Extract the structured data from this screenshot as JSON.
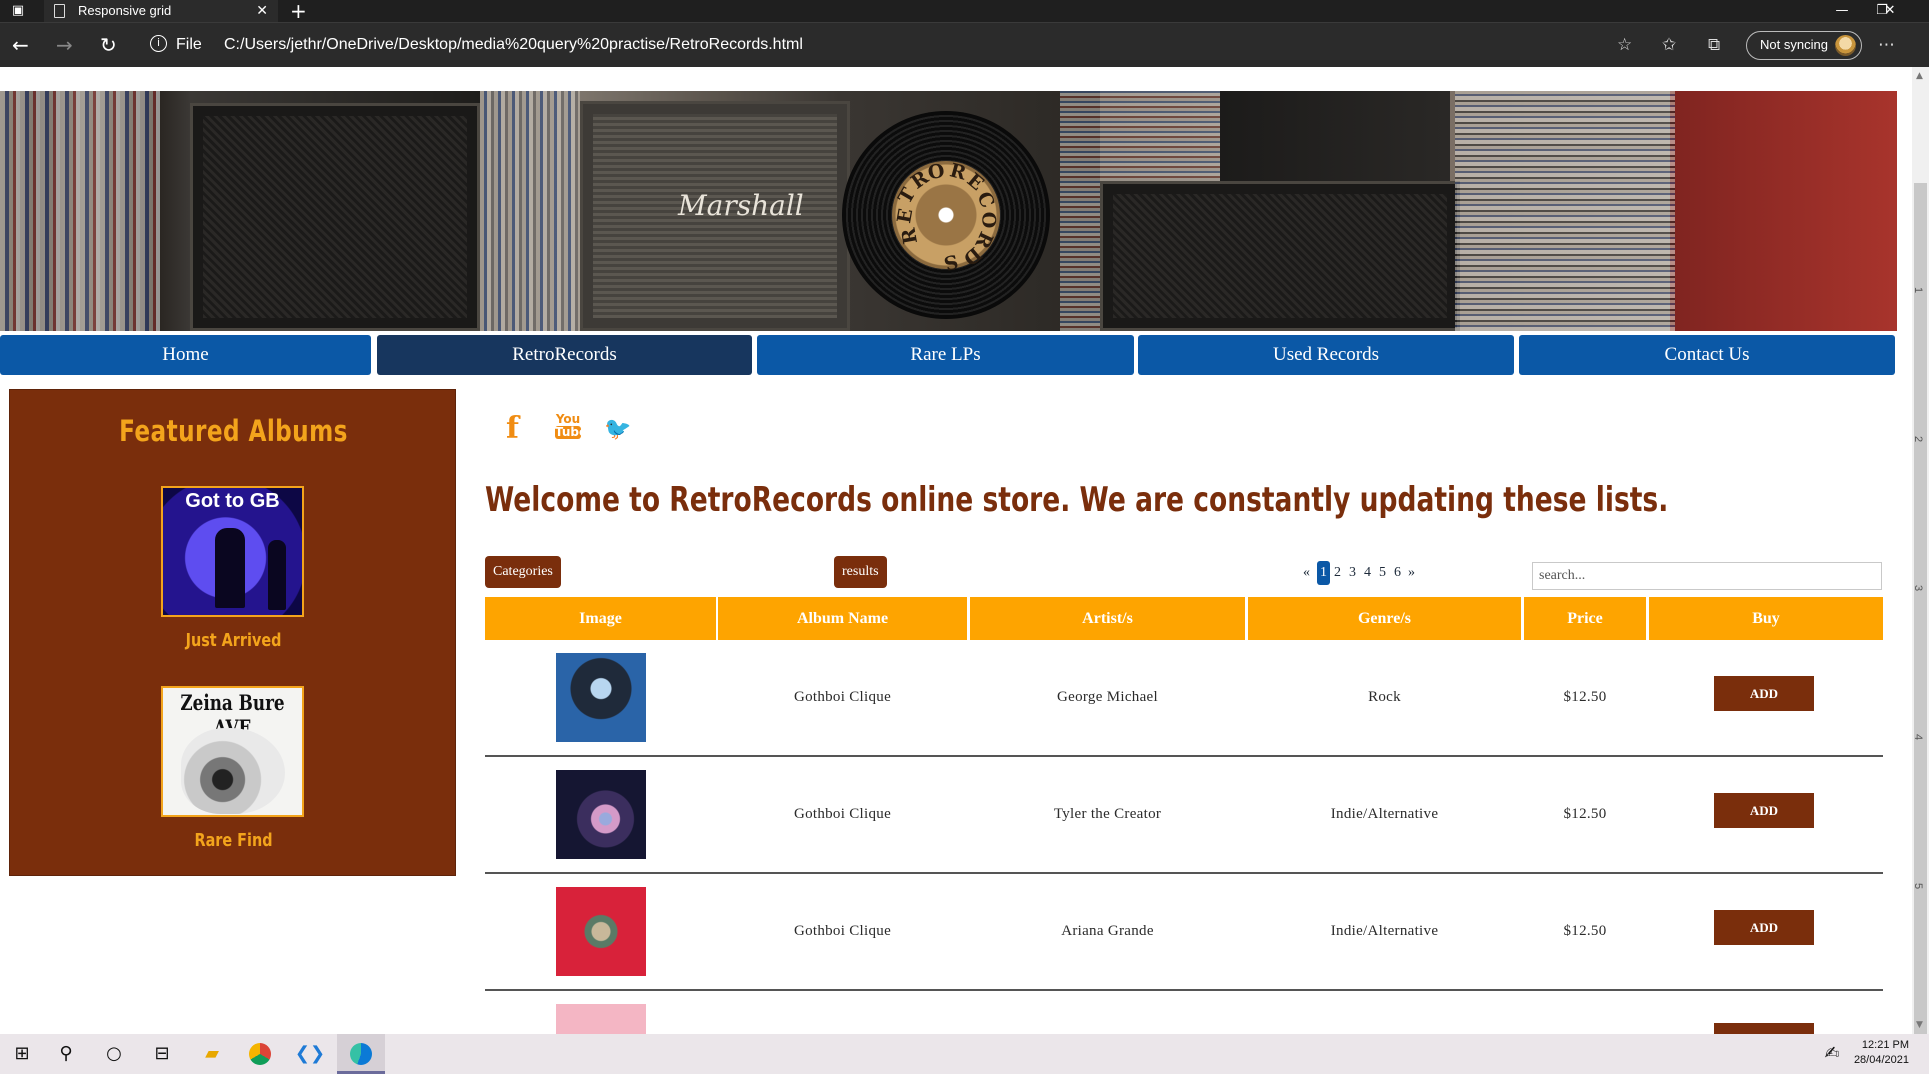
{
  "browser": {
    "tab_title": "Responsive grid",
    "tab_close": "✕",
    "new_tab": "+",
    "window_controls": [
      "—",
      "❐",
      "✕"
    ],
    "nav_icons": [
      "back-icon",
      "forward-icon",
      "refresh-icon"
    ],
    "url_scheme": "File",
    "url": "C:/Users/jethr/OneDrive/Desktop/media%20query%20practise/RetroRecords.html",
    "sync_label": "Not syncing",
    "more_icon": "⋯"
  },
  "site": {
    "banner_brand_text": "Marshall",
    "logo_letters": "RETRO RECORDS",
    "nav": [
      "Home",
      "RetroRecords",
      "Rare LPs",
      "Used Records",
      "Contact Us"
    ],
    "active_nav": "RetroRecords"
  },
  "sidebar": {
    "title": "Featured Albums",
    "albums": [
      {
        "cover_text": "Got to GB",
        "caption": "Just Arrived"
      },
      {
        "cover_text": "Zeina Bure AVE",
        "caption": "Rare Find"
      }
    ]
  },
  "social": {
    "facebook": "f",
    "youtube_top": "You",
    "youtube_bottom": "Tube",
    "twitter": "🐦"
  },
  "main": {
    "welcome": "Welcome to RetroRecords online store. We are constantly updating these lists.",
    "categories_label": "Categories",
    "results_label": "results",
    "pagination": [
      "«",
      "1",
      "2",
      "3",
      "4",
      "5",
      "6",
      "»"
    ],
    "current_page": "1",
    "search_placeholder": "search..."
  },
  "table": {
    "headers": [
      "Image",
      "Album Name",
      "Artist/s",
      "Genre/s",
      "Price",
      "Buy"
    ],
    "rows": [
      {
        "album": "Gothboi Clique",
        "artist": "George Michael",
        "genre": "Rock",
        "price": "$12.50",
        "buy": "ADD",
        "cover_color": "#2a64a8"
      },
      {
        "album": "Gothboi Clique",
        "artist": "Tyler the Creator",
        "genre": "Indie/Alternative",
        "price": "$12.50",
        "buy": "ADD",
        "cover_color": "#151632"
      },
      {
        "album": "Gothboi Clique",
        "artist": "Ariana Grande",
        "genre": "Indie/Alternative",
        "price": "$12.50",
        "buy": "ADD",
        "cover_color": "#d8223a"
      },
      {
        "album": "",
        "artist": "",
        "genre": "",
        "price": "",
        "buy": "",
        "cover_color": "#f4b6c4"
      }
    ]
  },
  "colors": {
    "nav_blue": "#0b58a6",
    "nav_active": "#17365e",
    "brown": "#7a2e0c",
    "orange": "#fea400",
    "accent_orange": "#f3a41c"
  },
  "taskbar": {
    "time": "12:21 PM",
    "date": "28/04/2021",
    "icons": [
      "windows-icon",
      "search-icon",
      "cortana-icon",
      "task-view-icon",
      "file-explorer-icon",
      "chrome-icon",
      "vscode-icon",
      "edge-icon"
    ]
  },
  "ruler": [
    "1",
    "2",
    "3",
    "4",
    "5"
  ]
}
